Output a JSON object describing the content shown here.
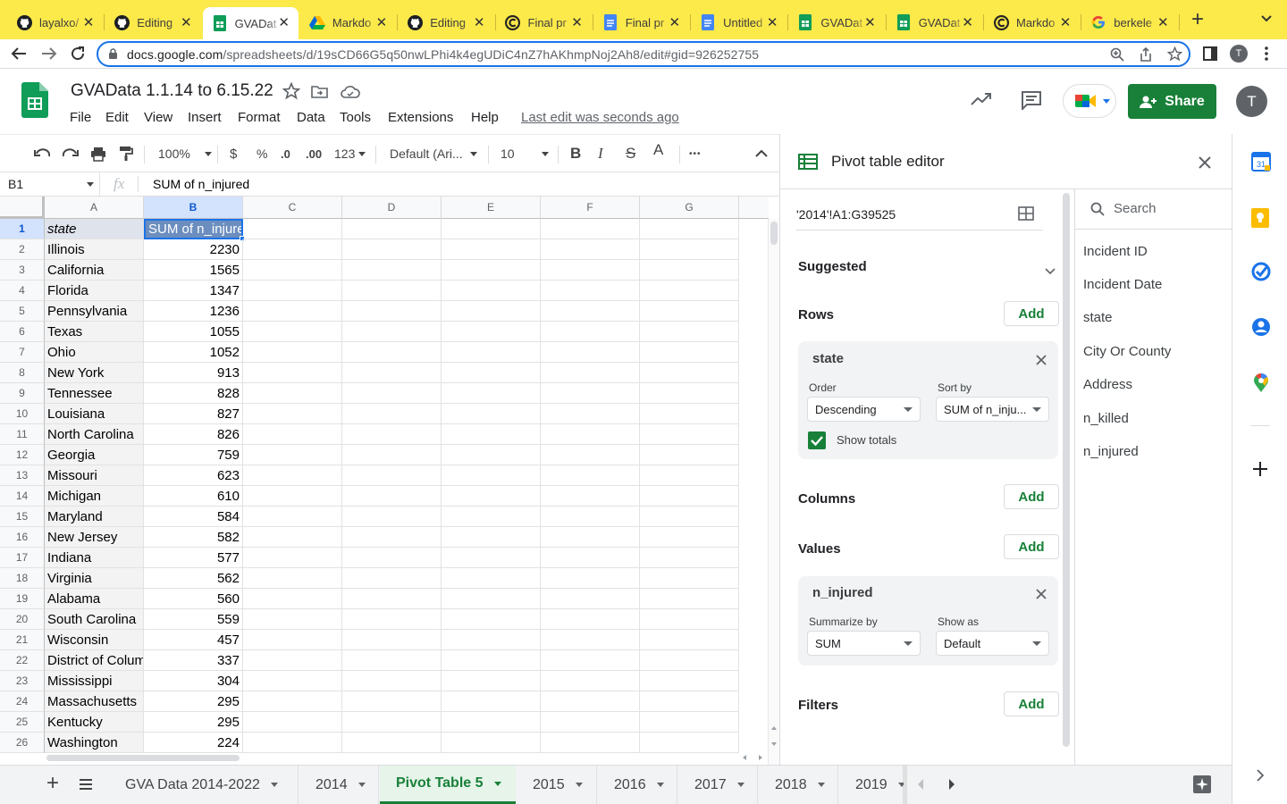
{
  "browser": {
    "tabs": [
      {
        "title": "layalxo/",
        "icon": "github-icon"
      },
      {
        "title": "Editing",
        "icon": "github-icon"
      },
      {
        "title": "GVADat",
        "icon": "sheets-icon"
      },
      {
        "title": "Markdo",
        "icon": "drive-icon"
      },
      {
        "title": "Editing",
        "icon": "github-icon"
      },
      {
        "title": "Final pr",
        "icon": "circle-c-icon"
      },
      {
        "title": "Final pr",
        "icon": "docs-icon"
      },
      {
        "title": "Untitled",
        "icon": "docs-icon"
      },
      {
        "title": "GVADat",
        "icon": "sheets-icon"
      },
      {
        "title": "GVADat",
        "icon": "sheets-icon"
      },
      {
        "title": "Markdo",
        "icon": "circle-c-icon"
      },
      {
        "title": "berkele",
        "icon": "google-icon"
      }
    ],
    "url_host": "docs.google.com",
    "url_path": "/spreadsheets/d/19sCD66G5q50nwLPhi4k4egUDiC4nZ7hAKhmpNoj2Ah8/edit#gid=926252755",
    "profile_initial": "T"
  },
  "doc": {
    "title": "GVAData 1.1.14 to 6.15.22",
    "menus": [
      "File",
      "Edit",
      "View",
      "Insert",
      "Format",
      "Data",
      "Tools",
      "Extensions",
      "Help"
    ],
    "last_edit": "Last edit was seconds ago",
    "share_label": "Share",
    "avatar": "T"
  },
  "toolbar": {
    "zoom": "100%",
    "currency": "$",
    "percent": "%",
    "dec_less": ".0",
    "dec_more": ".00",
    "format_more": "123",
    "font": "Default (Ari...",
    "font_size": "10",
    "bold": "B",
    "italic": "I",
    "strike": "S",
    "text_color": "A",
    "more": "•••"
  },
  "formula": {
    "cell_ref": "B1",
    "fx": "fx",
    "content": "SUM of n_injured"
  },
  "grid": {
    "columns": [
      "A",
      "B",
      "C",
      "D",
      "E",
      "F",
      "G"
    ],
    "header": [
      "state",
      "SUM of n_injure"
    ],
    "rows": [
      [
        "Illinois",
        "2230"
      ],
      [
        "California",
        "1565"
      ],
      [
        "Florida",
        "1347"
      ],
      [
        "Pennsylvania",
        "1236"
      ],
      [
        "Texas",
        "1055"
      ],
      [
        "Ohio",
        "1052"
      ],
      [
        "New York",
        "913"
      ],
      [
        "Tennessee",
        "828"
      ],
      [
        "Louisiana",
        "827"
      ],
      [
        "North Carolina",
        "826"
      ],
      [
        "Georgia",
        "759"
      ],
      [
        "Missouri",
        "623"
      ],
      [
        "Michigan",
        "610"
      ],
      [
        "Maryland",
        "584"
      ],
      [
        "New Jersey",
        "582"
      ],
      [
        "Indiana",
        "577"
      ],
      [
        "Virginia",
        "562"
      ],
      [
        "Alabama",
        "560"
      ],
      [
        "South Carolina",
        "559"
      ],
      [
        "Wisconsin",
        "457"
      ],
      [
        "District of Colum",
        "337"
      ],
      [
        "Mississippi",
        "304"
      ],
      [
        "Massachusetts",
        "295"
      ],
      [
        "Kentucky",
        "295"
      ],
      [
        "Washington",
        "224"
      ]
    ]
  },
  "sheets": {
    "tabs": [
      "GVA Data 2014-2022",
      "2014",
      "Pivot Table 5",
      "2015",
      "2016",
      "2017",
      "2018",
      "2019"
    ],
    "active": "Pivot Table 5"
  },
  "pivot": {
    "title": "Pivot table editor",
    "range": "'2014'!A1:G39525",
    "suggested": "Suggested",
    "rows_label": "Rows",
    "columns_label": "Columns",
    "values_label": "Values",
    "filters_label": "Filters",
    "add_label": "Add",
    "row_field": {
      "name": "state",
      "order_label": "Order",
      "order_value": "Descending",
      "sortby_label": "Sort by",
      "sortby_value": "SUM of n_inju...",
      "show_totals": "Show totals"
    },
    "value_field": {
      "name": "n_injured",
      "summarize_label": "Summarize by",
      "summarize_value": "SUM",
      "showas_label": "Show as",
      "showas_value": "Default"
    },
    "search_placeholder": "Search",
    "fields": [
      "Incident ID",
      "Incident Date",
      "state",
      "City Or County",
      "Address",
      "n_killed",
      "n_injured"
    ]
  },
  "colors": {
    "accent": "#1a73e8",
    "sheets_green": "#188038",
    "share_green": "#188038",
    "tabbar": "#fce94a",
    "selection": "#c6dafc"
  }
}
